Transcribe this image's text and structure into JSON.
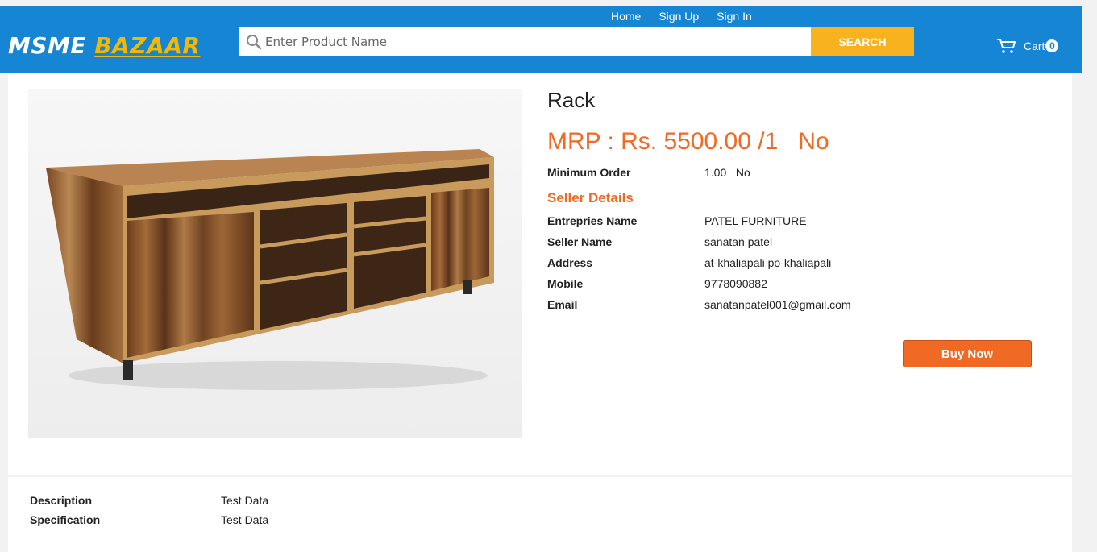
{
  "nav": {
    "links": [
      "Home",
      "Sign Up",
      "Sign In"
    ]
  },
  "logo": {
    "part1": "MSME ",
    "part2": "BAZAAR"
  },
  "search": {
    "placeholder": "Enter Product Name",
    "button_label": "SEARCH"
  },
  "cart": {
    "label": "Cart",
    "count": "0",
    "icon": "cart-icon"
  },
  "product": {
    "title": "Rack",
    "price_label": "MRP :",
    "price_value": "Rs. 5500.00 /1",
    "price_unit": "No",
    "min_order_label": "Minimum Order",
    "min_order_value": "1.00   No"
  },
  "seller": {
    "heading": "Seller Details",
    "rows": [
      {
        "label": "Entrepries Name",
        "value": "PATEL FURNITURE"
      },
      {
        "label": "Seller Name",
        "value": "sanatan patel"
      },
      {
        "label": "Address",
        "value": "at-khaliapali po-khaliapali"
      },
      {
        "label": "Mobile",
        "value": "9778090882"
      },
      {
        "label": "Email",
        "value": "sanatanpatel001@gmail.com"
      }
    ]
  },
  "buy_label": "Buy Now",
  "info": [
    {
      "label": "Description",
      "value": "Test Data"
    },
    {
      "label": "Specification",
      "value": "Test Data"
    }
  ],
  "colors": {
    "header": "#1685d3",
    "accent": "#f06a24",
    "search_button": "#f7b21d"
  }
}
